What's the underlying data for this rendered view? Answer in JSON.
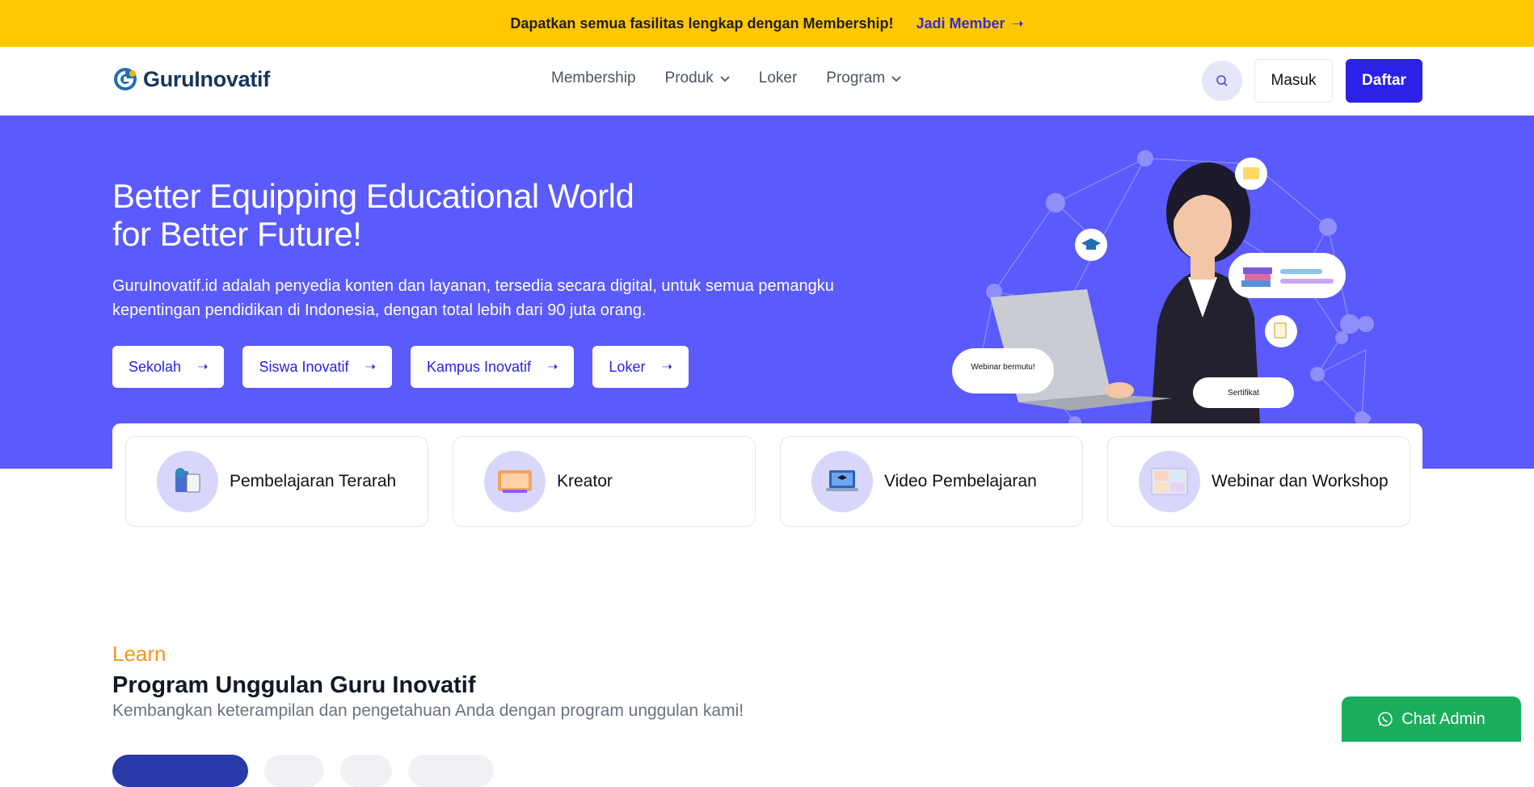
{
  "banner": {
    "message": "Dapatkan semua fasilitas lengkap dengan Membership!",
    "cta": "Jadi Member",
    "cta_arrow": "➝",
    "bg_color": "#ffc800"
  },
  "nav": {
    "brand": "GuruInovatif",
    "items": [
      {
        "label": "Membership",
        "has_dropdown": false
      },
      {
        "label": "Produk",
        "has_dropdown": true
      },
      {
        "label": "Loker",
        "has_dropdown": false
      },
      {
        "label": "Program",
        "has_dropdown": true
      }
    ],
    "search_icon": "search-icon",
    "login_label": "Masuk",
    "register_label": "Daftar",
    "accent_color": "#2b22e6"
  },
  "hero": {
    "title_line1": "Better Equipping Educational World",
    "title_line2": "for Better Future!",
    "description": "GuruInovatif.id adalah penyedia konten dan layanan, tersedia secara digital, untuk semua pemangku kepentingan pendidikan di Indonesia, dengan total lebih dari 90 juta orang.",
    "buttons": [
      {
        "label": "Sekolah"
      },
      {
        "label": "Siswa Inovatif"
      },
      {
        "label": "Kampus Inovatif"
      },
      {
        "label": "Loker"
      }
    ],
    "arrow": "➝",
    "bubble_webinar": "Webinar bermutu!",
    "bubble_certificate": "Sertifikat",
    "bg_color": "#5a5afd"
  },
  "features": [
    {
      "label": "Pembelajaran Terarah",
      "icon": "books-icon"
    },
    {
      "label": "Kreator",
      "icon": "creator-icon"
    },
    {
      "label": "Video Pembelajaran",
      "icon": "laptop-icon"
    },
    {
      "label": "Webinar dan Workshop",
      "icon": "video-call-icon"
    }
  ],
  "learn": {
    "eyebrow": "Learn",
    "title": "Program Unggulan Guru Inovatif",
    "subtitle": "Kembangkan keterampilan dan pengetahuan Anda dengan program unggulan kami!"
  },
  "chat": {
    "label": "Chat Admin",
    "icon": "whatsapp-icon",
    "color": "#1aae5c"
  }
}
